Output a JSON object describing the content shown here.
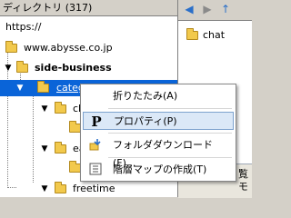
{
  "left_header": {
    "title": "ディレクトリ (317)"
  },
  "tree": {
    "root": "https://",
    "domain": "www.abysse.co.jp",
    "site": "side-business",
    "selected": "category",
    "child1": "chat",
    "child2": "easy",
    "child3": "freetime"
  },
  "right": {
    "item": "chat",
    "nav_icons": [
      "back-icon",
      "forward-icon",
      "up-icon"
    ],
    "partial_text_1": "覧",
    "partial_text_2": "モ"
  },
  "context_menu": {
    "items": [
      {
        "label": "折りたたみ(A)",
        "icon": ""
      },
      {
        "label": "プロパティ(P)",
        "icon": "P"
      },
      {
        "label": "フォルダダウンロード(F)...",
        "icon": "download-icon"
      },
      {
        "label": "階層マップの作成(T)",
        "icon": "map-icon"
      }
    ]
  },
  "colors": {
    "selection": "#0a64d8",
    "menu_hover": "#dbe8f7",
    "folder": "#f2c94c"
  }
}
